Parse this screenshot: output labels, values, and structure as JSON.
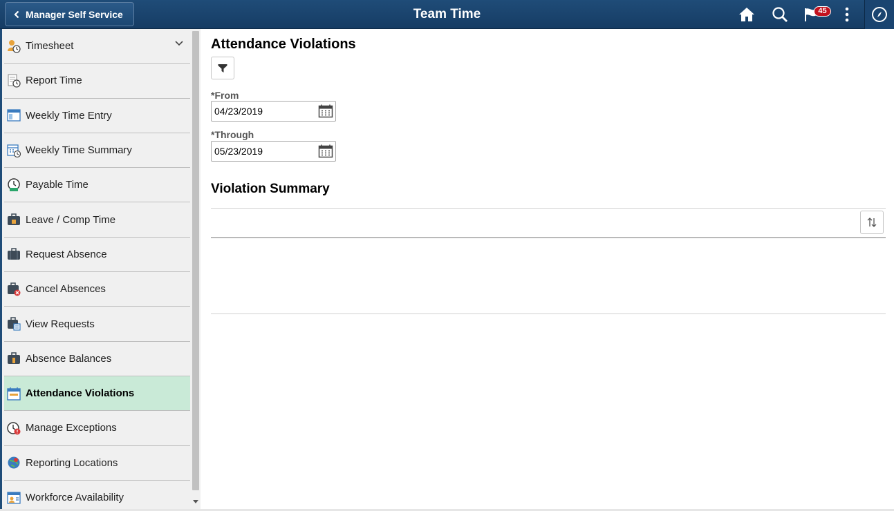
{
  "header": {
    "back_label": "Manager Self Service",
    "title": "Team Time",
    "notification_count": "45",
    "icons": [
      "home-icon",
      "search-icon",
      "notification-flag-icon",
      "more-actions-icon",
      "navbar-compass-icon"
    ]
  },
  "sidebar": {
    "items": [
      {
        "label": "Timesheet",
        "icon": "timesheet-icon"
      },
      {
        "label": "Report Time",
        "icon": "report-time-icon"
      },
      {
        "label": "Weekly Time Entry",
        "icon": "weekly-entry-icon"
      },
      {
        "label": "Weekly Time Summary",
        "icon": "weekly-summary-icon"
      },
      {
        "label": "Payable Time",
        "icon": "payable-time-icon"
      },
      {
        "label": "Leave / Comp Time",
        "icon": "briefcase-icon"
      },
      {
        "label": "Request Absence",
        "icon": "briefcase-icon"
      },
      {
        "label": "Cancel Absences",
        "icon": "briefcase-cancel-icon"
      },
      {
        "label": "View Requests",
        "icon": "briefcase-calendar-icon"
      },
      {
        "label": "Absence Balances",
        "icon": "briefcase-balance-icon"
      },
      {
        "label": "Attendance Violations",
        "icon": "calendar-icon",
        "active": true
      },
      {
        "label": "Manage Exceptions",
        "icon": "exceptions-icon"
      },
      {
        "label": "Reporting Locations",
        "icon": "globe-location-icon"
      },
      {
        "label": "Workforce Availability",
        "icon": "workforce-icon"
      }
    ]
  },
  "main": {
    "title": "Attendance Violations",
    "from_label": "*From",
    "from_value": "04/23/2019",
    "through_label": "*Through",
    "through_value": "05/23/2019",
    "section_title": "Violation Summary"
  },
  "colors": {
    "header_bg": "#1f4c78",
    "active_item_bg": "#c9ead7",
    "badge": "#c2121e"
  }
}
